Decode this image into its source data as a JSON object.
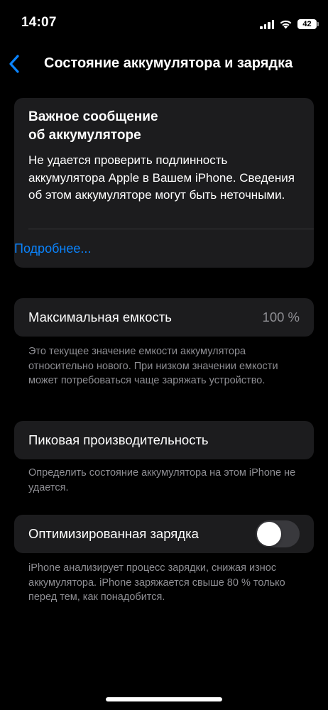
{
  "status_bar": {
    "time": "14:07",
    "battery_level": "42",
    "icons": [
      "cellular-signal-icon",
      "wifi-icon",
      "battery-icon"
    ]
  },
  "nav": {
    "back_icon": "chevron-left-icon",
    "title": "Состояние аккумулятора и зарядка",
    "accent_color": "#0a84ff"
  },
  "alert": {
    "title_line1": "Важное сообщение",
    "title_line2": "об аккумуляторе",
    "body": "Не удается проверить подлинность аккумулятора Apple в Вашем iPhone. Сведения об этом аккумуляторе могут быть неточными.",
    "link": "Подробнее..."
  },
  "max_capacity": {
    "label": "Максимальная емкость",
    "value": "100 %",
    "footnote": "Это текущее значение емкости аккумулятора относительно нового. При низком значении емкости может потребоваться чаще заряжать устройство."
  },
  "peak_performance": {
    "label": "Пиковая производительность",
    "footnote": "Определить состояние аккумулятора на этом iPhone не удается."
  },
  "optimized_charging": {
    "label": "Оптимизированная зарядка",
    "enabled": false,
    "footnote": "iPhone анализирует процесс зарядки, снижая износ аккумулятора. iPhone заряжается свыше 80 % только перед тем, как понадобится."
  },
  "colors": {
    "background": "#000000",
    "card": "#1c1c1e",
    "secondary_text": "#8e8e93",
    "link": "#0a84ff",
    "toggle_off": "#39393d"
  }
}
